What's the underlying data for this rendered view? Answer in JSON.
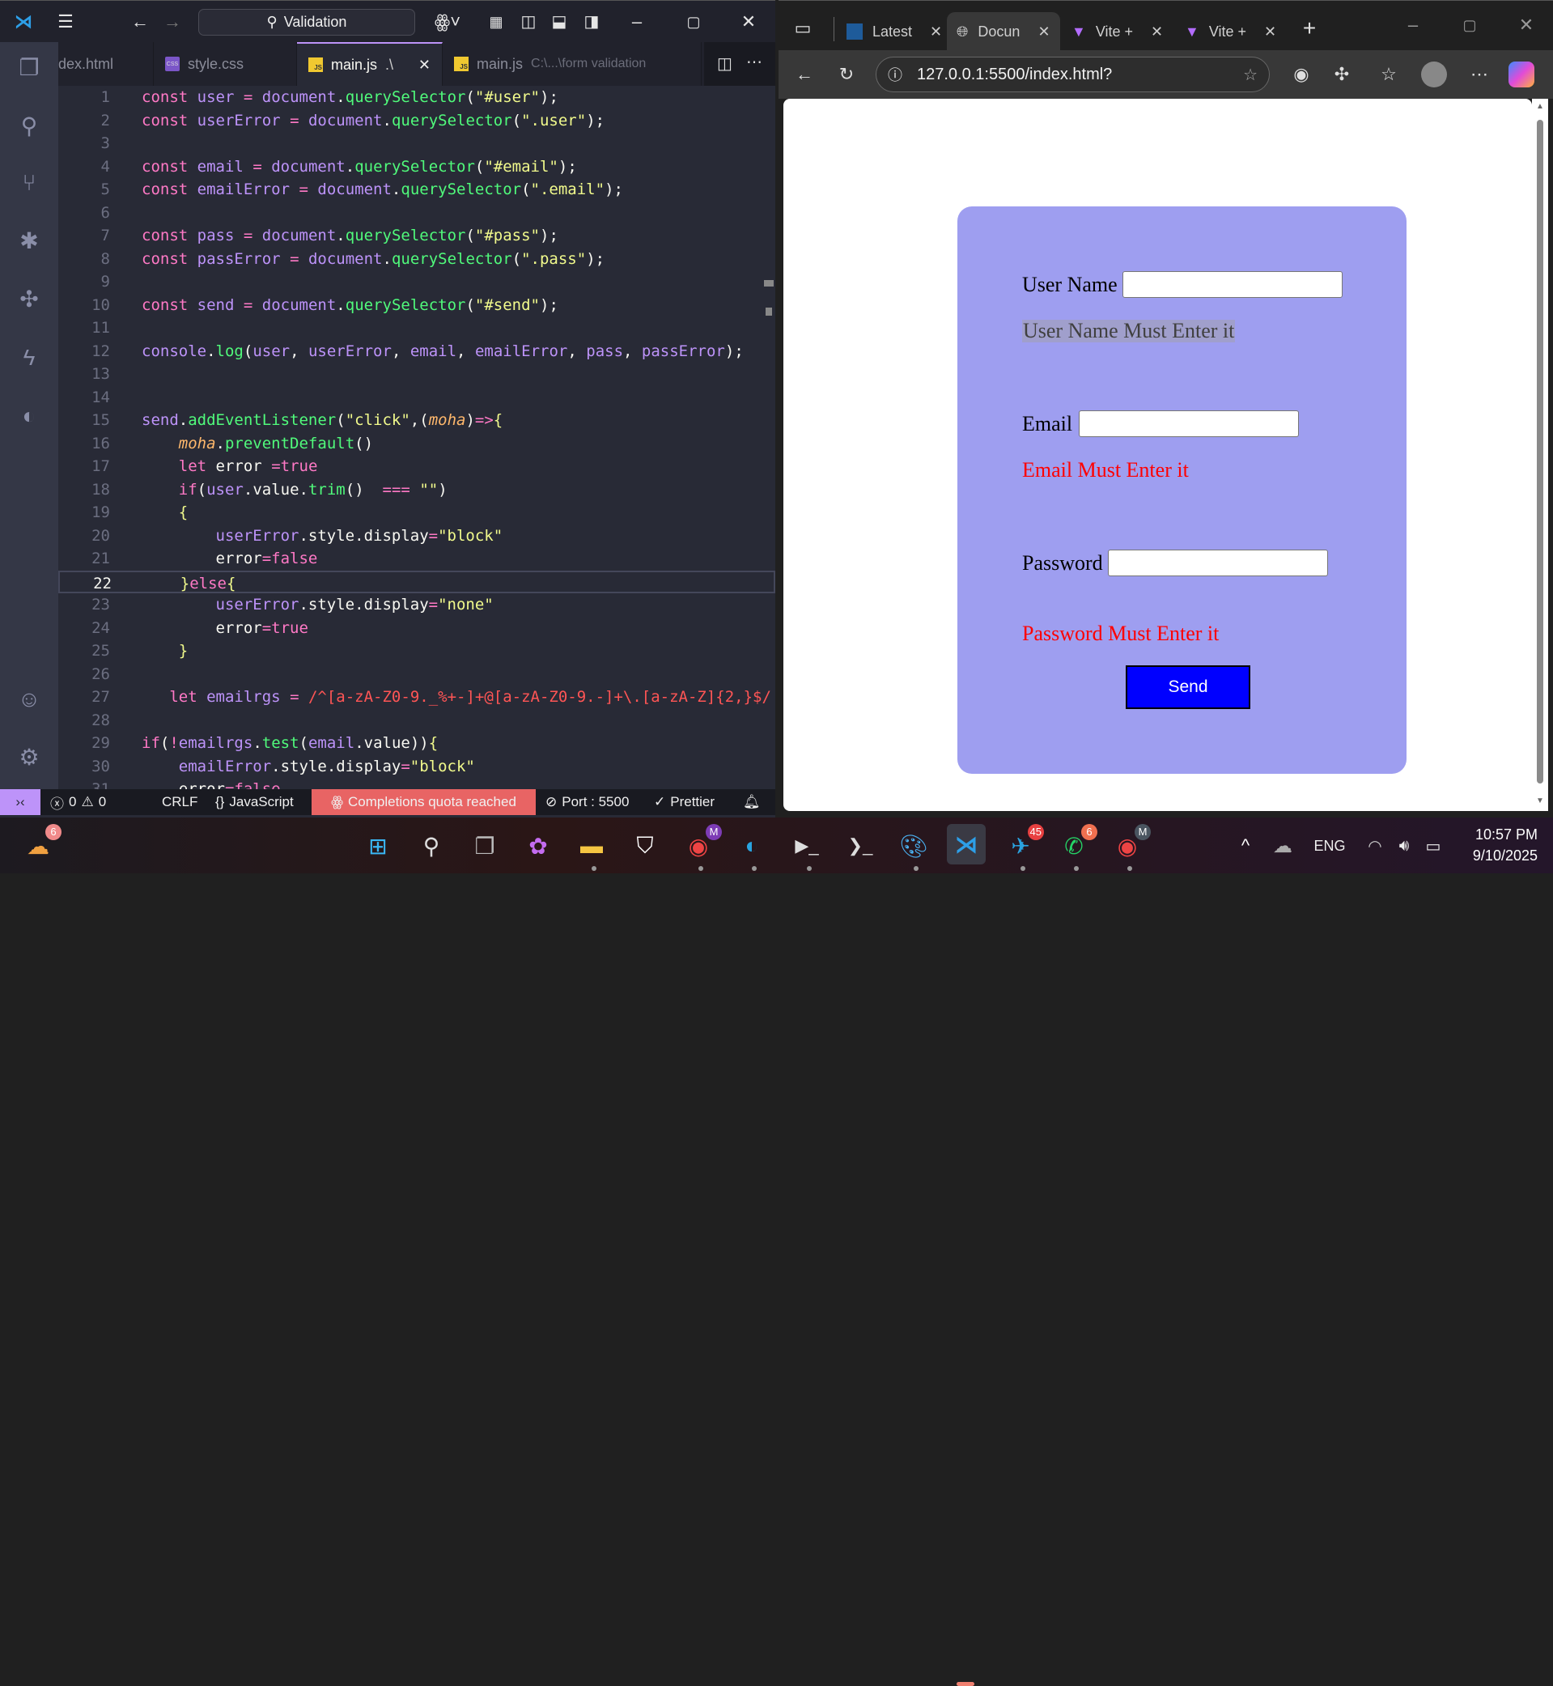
{
  "vscode": {
    "search_text": "Validation",
    "tabs": [
      {
        "label": "dex.html"
      },
      {
        "label": "style.css",
        "icon": "CSS"
      },
      {
        "label": "main.js",
        "suffix": ".\\",
        "icon": "JS"
      },
      {
        "label": "main.js",
        "suffix": "C:\\...\\form validation",
        "icon": "JS"
      }
    ],
    "current_line": 22,
    "code_lines": [
      "const user = document.querySelector(\"#user\");",
      "const userError = document.querySelector(\".user\");",
      "",
      "const email = document.querySelector(\"#email\");",
      "const emailError = document.querySelector(\".email\");",
      "",
      "const pass = document.querySelector(\"#pass\");",
      "const passError = document.querySelector(\".pass\");",
      "",
      "const send = document.querySelector(\"#send\");",
      "",
      "console.log(user, userError, email, emailError, pass, passError);",
      "",
      "",
      "send.addEventListener(\"click\",(moha)=>{",
      "    moha.preventDefault()",
      "    let error =true",
      "    if(user.value.trim()  === \"\")",
      "    {",
      "        userError.style.display=\"block\"",
      "        error=false",
      "    }else{",
      "        userError.style.display=\"none\"",
      "        error=true",
      "    }",
      "",
      "   let emailrgs = /^[a-zA-Z0-9._%+-]+@[a-zA-Z0-9.-]+\\.[a-zA-Z]{2,}$/",
      "",
      "if(!emailrgs.test(email.value)){",
      "    emailError.style.display=\"block\"",
      "    error=false"
    ],
    "status": {
      "errors": "0",
      "warnings": "0",
      "eol": "CRLF",
      "language": "JavaScript",
      "copilot": "Completions quota reached",
      "port": "Port : 5500",
      "prettier": "Prettier"
    }
  },
  "browser": {
    "tabs": [
      {
        "label": "Latest"
      },
      {
        "label": "Docun"
      },
      {
        "label": "Vite +"
      },
      {
        "label": "Vite +"
      }
    ],
    "url": "127.0.0.1:5500/index.html?",
    "form": {
      "user_label": "User Name",
      "user_error": "User Name Must Enter it",
      "email_label": "Email",
      "email_error": "Email Must Enter it",
      "pass_label": "Password",
      "pass_error": "Password Must Enter it",
      "send_label": "Send"
    }
  },
  "taskbar": {
    "weather_badge": "6",
    "chrome_profile": "M",
    "telegram_badge": "45",
    "whatsapp_badge": "6",
    "language": "ENG",
    "time": "10:57 PM",
    "date": "9/10/2025"
  },
  "colors": {
    "card_bg": "#9e9ef0",
    "error_red": "#ff0000",
    "send_blue": "#0000ff",
    "copilot_status_bg": "#e86464"
  }
}
